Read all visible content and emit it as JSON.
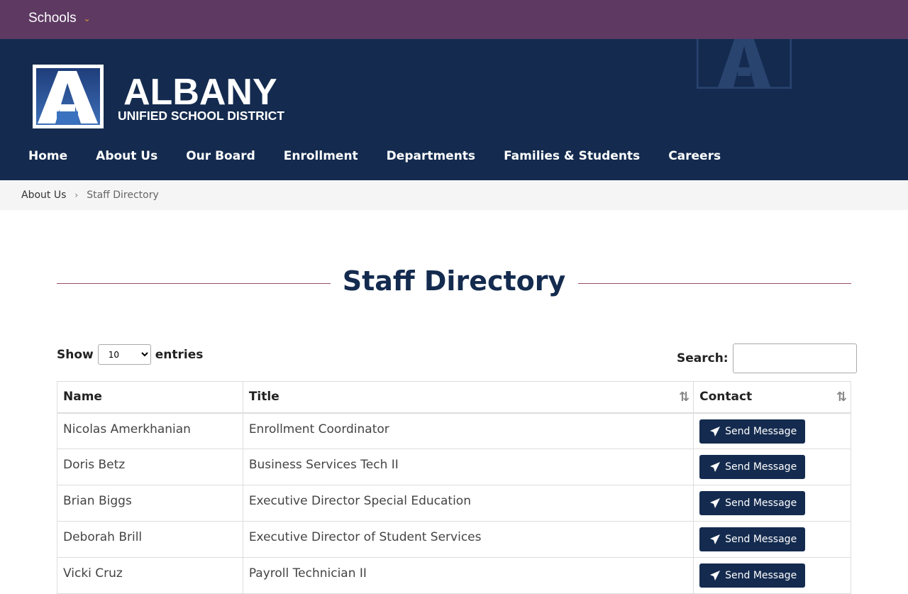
{
  "topbar": {
    "schools_label": "Schools",
    "chevron_icon": "chevron-down-icon"
  },
  "header": {
    "logo": {
      "name": "ALBANY",
      "subtitle": "UNIFIED SCHOOL DISTRICT"
    },
    "nav": [
      "Home",
      "About Us",
      "Our Board",
      "Enrollment",
      "Departments",
      "Families & Students",
      "Careers"
    ]
  },
  "breadcrumb": {
    "parent": "About Us",
    "separator_icon": "chevron-right-icon",
    "current": "Staff Directory"
  },
  "page": {
    "title": "Staff Directory"
  },
  "controls": {
    "show_label": "Show",
    "page_size": "10",
    "entries_label": "entries",
    "search_label": "Search:",
    "search_value": ""
  },
  "table": {
    "headers": {
      "name": "Name",
      "title": "Title",
      "contact": "Contact"
    },
    "send_label": "Send Message",
    "rows": [
      {
        "name": "Nicolas Amerkhanian",
        "title": "Enrollment Coordinator"
      },
      {
        "name": "Doris Betz",
        "title": "Business Services Tech II"
      },
      {
        "name": "Brian Biggs",
        "title": "Executive Director Special Education"
      },
      {
        "name": "Deborah Brill",
        "title": "Executive Director of Student Services"
      },
      {
        "name": "Vicki Cruz",
        "title": "Payroll Technician II"
      }
    ]
  },
  "colors": {
    "topbar": "#5e3a63",
    "header": "#142b4f",
    "accent_line": "#9b4a6c",
    "button": "#142b4f"
  }
}
